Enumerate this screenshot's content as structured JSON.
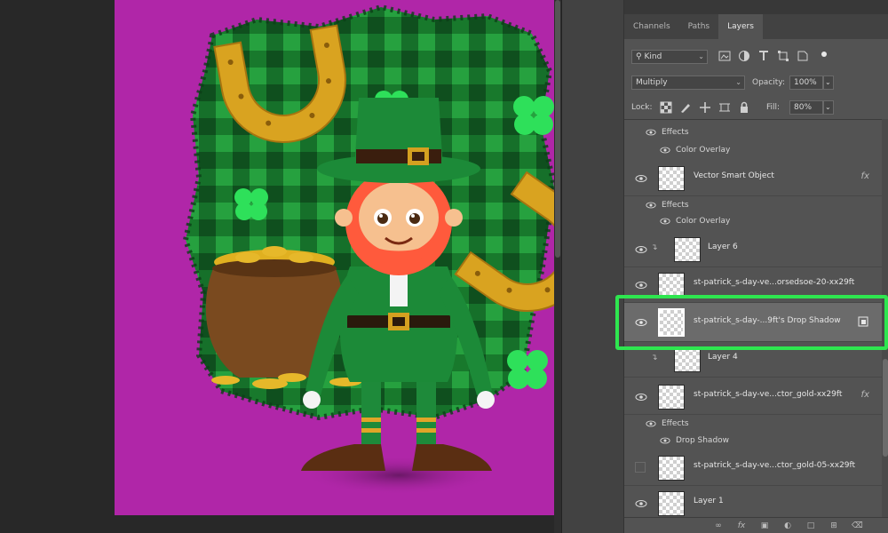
{
  "panel": {
    "tabs": [
      {
        "label": "Channels",
        "active": false
      },
      {
        "label": "Paths",
        "active": false
      },
      {
        "label": "Layers",
        "active": true
      }
    ],
    "filter": {
      "value": "Kind"
    },
    "blend_mode": {
      "value": "Multiply"
    },
    "opacity": {
      "label": "Opacity:",
      "value": "100%"
    },
    "lock": {
      "label": "Lock:"
    },
    "fill": {
      "label": "Fill:",
      "value": "80%"
    }
  },
  "layers": {
    "top_effects_label": "Effects",
    "top_color_overlay": "Color Overlay",
    "vector": {
      "name": "Vector Smart Object",
      "fx": "fx"
    },
    "vector_effects": "Effects",
    "vector_color_overlay": "Color Overlay",
    "layer6": {
      "name": "Layer 6"
    },
    "st_lorem": {
      "name": "st-patrick_s-day-ve...orsedsoe-20-xx29ft"
    },
    "drop_shadow_layer": {
      "name": "st-patrick_s-day-...9ft's Drop Shadow"
    },
    "layer4": {
      "name": "Layer 4"
    },
    "gold": {
      "name": "st-patrick_s-day-ve...ctor_gold-xx29ft",
      "fx": "fx"
    },
    "gold_effects": "Effects",
    "gold_drop_shadow": "Drop Shadow",
    "gold05": {
      "name": "st-patrick_s-day-ve...ctor_gold-05-xx29ft"
    },
    "layer1": {
      "name": "Layer 1"
    }
  },
  "bottom_icons": [
    "link-icon",
    "fx-icon",
    "mask-icon",
    "adjustment-icon",
    "folder-icon",
    "new-layer-icon",
    "trash-icon"
  ],
  "colors": {
    "artboard": "#b026a8",
    "highlight": "#2ee64f"
  }
}
